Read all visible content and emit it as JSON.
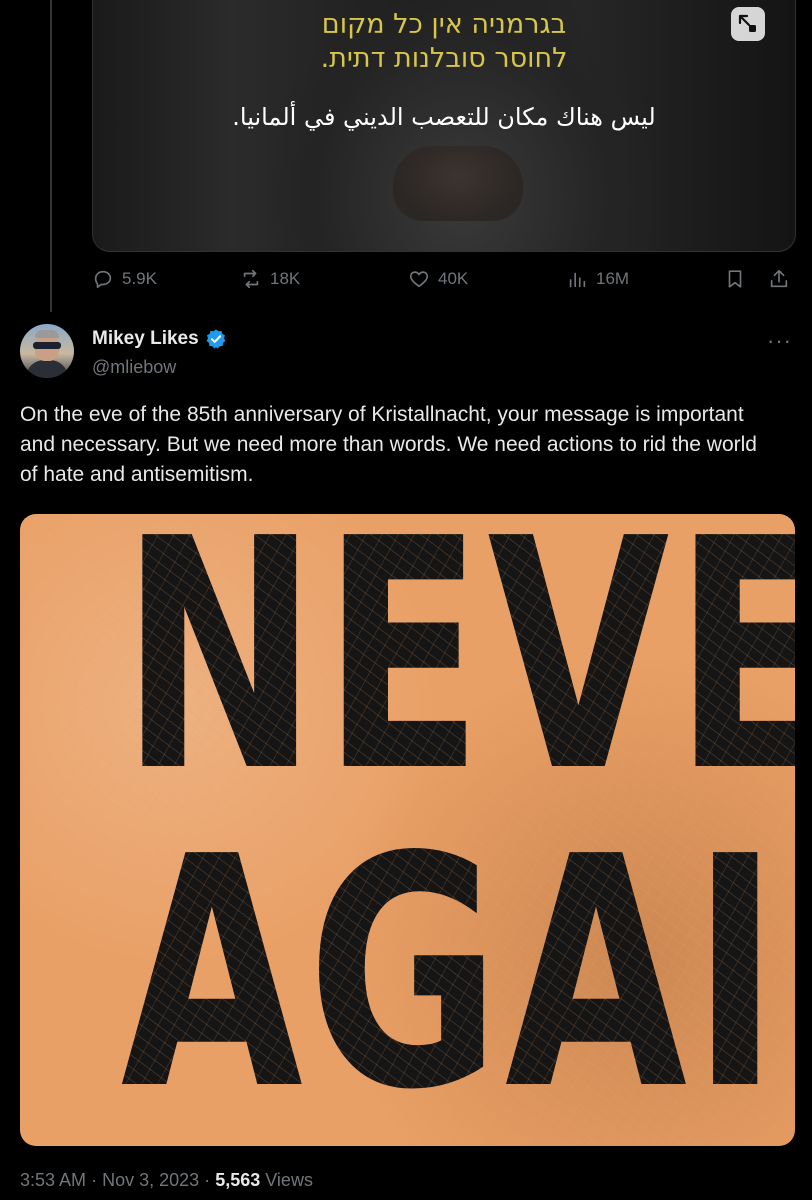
{
  "previous_tweet": {
    "subtitles": {
      "hebrew_line1": "בגרמניה אין כל מקום",
      "hebrew_line2": "לחוסר סובלנות דתית.",
      "arabic_line": "ليس هناك مكان للتعصب الديني في ألمانيا."
    },
    "actions": {
      "replies": "5.9K",
      "reposts": "18K",
      "likes": "40K",
      "views": "16M"
    }
  },
  "tweet": {
    "author": {
      "display_name": "Mikey Likes",
      "handle": "@mliebow",
      "verified": true
    },
    "more_label": "···",
    "text": "On the eve of the 85th anniversary of Kristallnacht, your message is important and necessary. But we need more than words. We need actions to rid the world of hate and antisemitism.",
    "image_text": {
      "line1": "NEVER",
      "line2": "AGAIN!"
    },
    "meta": {
      "time": "3:53 AM",
      "separator": "·",
      "date": "Nov 3, 2023",
      "views_count": "5,563",
      "views_label": "Views"
    }
  },
  "colors": {
    "background": "#000000",
    "text_primary": "#e7e9ea",
    "text_secondary": "#71767b",
    "verified_blue": "#1d9bf0",
    "subtitle_yellow": "#d8c64a",
    "poster_orange": "#e9a066"
  },
  "icons": [
    "reply-icon",
    "repost-icon",
    "like-icon",
    "views-icon",
    "bookmark-icon",
    "share-icon",
    "expand-icon",
    "verified-badge-icon",
    "more-icon"
  ]
}
